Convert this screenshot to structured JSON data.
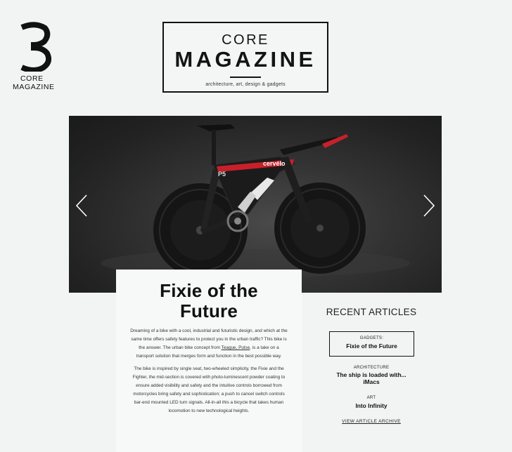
{
  "logo": {
    "icon": "number-three-icon",
    "line1": "CORE",
    "line2": "MAGAZINE"
  },
  "masthead": {
    "title_top": "CORE",
    "title_bottom": "MAGAZINE",
    "tagline": "architecture, art, design & gadgets"
  },
  "slider": {
    "prev_icon": "chevron-left-icon",
    "next_icon": "chevron-right-icon",
    "image": "time-trial-bicycle-photo",
    "bike_brand": "cervélo",
    "bike_model": "P5"
  },
  "article": {
    "title": "Fixie of the Future",
    "para1_before": "Dreaming of a bike with a cool, industrial and futuristic design, and which at the same time offers safety features to protect you in the urban traffic? This bike is the answer. The urban bike concept from",
    "para1_link": "Teague, Pulse",
    "para1_after": ", is a take on a transport solution that merges form and function in the best possible way.",
    "para2": "The bike is inspired by single seat, two-wheeled simplicity, the Fixie and the Fighter, the mid-section is covered with photo-luminescent powder coating to ensure added visibility and safety and the intuitive controls borrowed from motorcycles bring safety and sophistication; a push to cancel switch controls bar-end mounted LED turn signals. All-in-all this a bicycle that takes human locomotion to new technological heights."
  },
  "recent": {
    "heading": "RECENT ARTICLES",
    "items": [
      {
        "category": "GADGETS:",
        "title": "Fixie of the Future"
      },
      {
        "category": "ARCHITECTURE",
        "title": "The ship is loaded with... iMacs"
      },
      {
        "category": "ART",
        "title": "Into Infinity"
      }
    ],
    "archive_label": "VIEW ARTICLE ARCHIVE"
  },
  "colors": {
    "background": "#f2f3f3",
    "text": "#141414",
    "hero_bg": "#2b2b2b",
    "bike_accent": "#c8202a"
  }
}
